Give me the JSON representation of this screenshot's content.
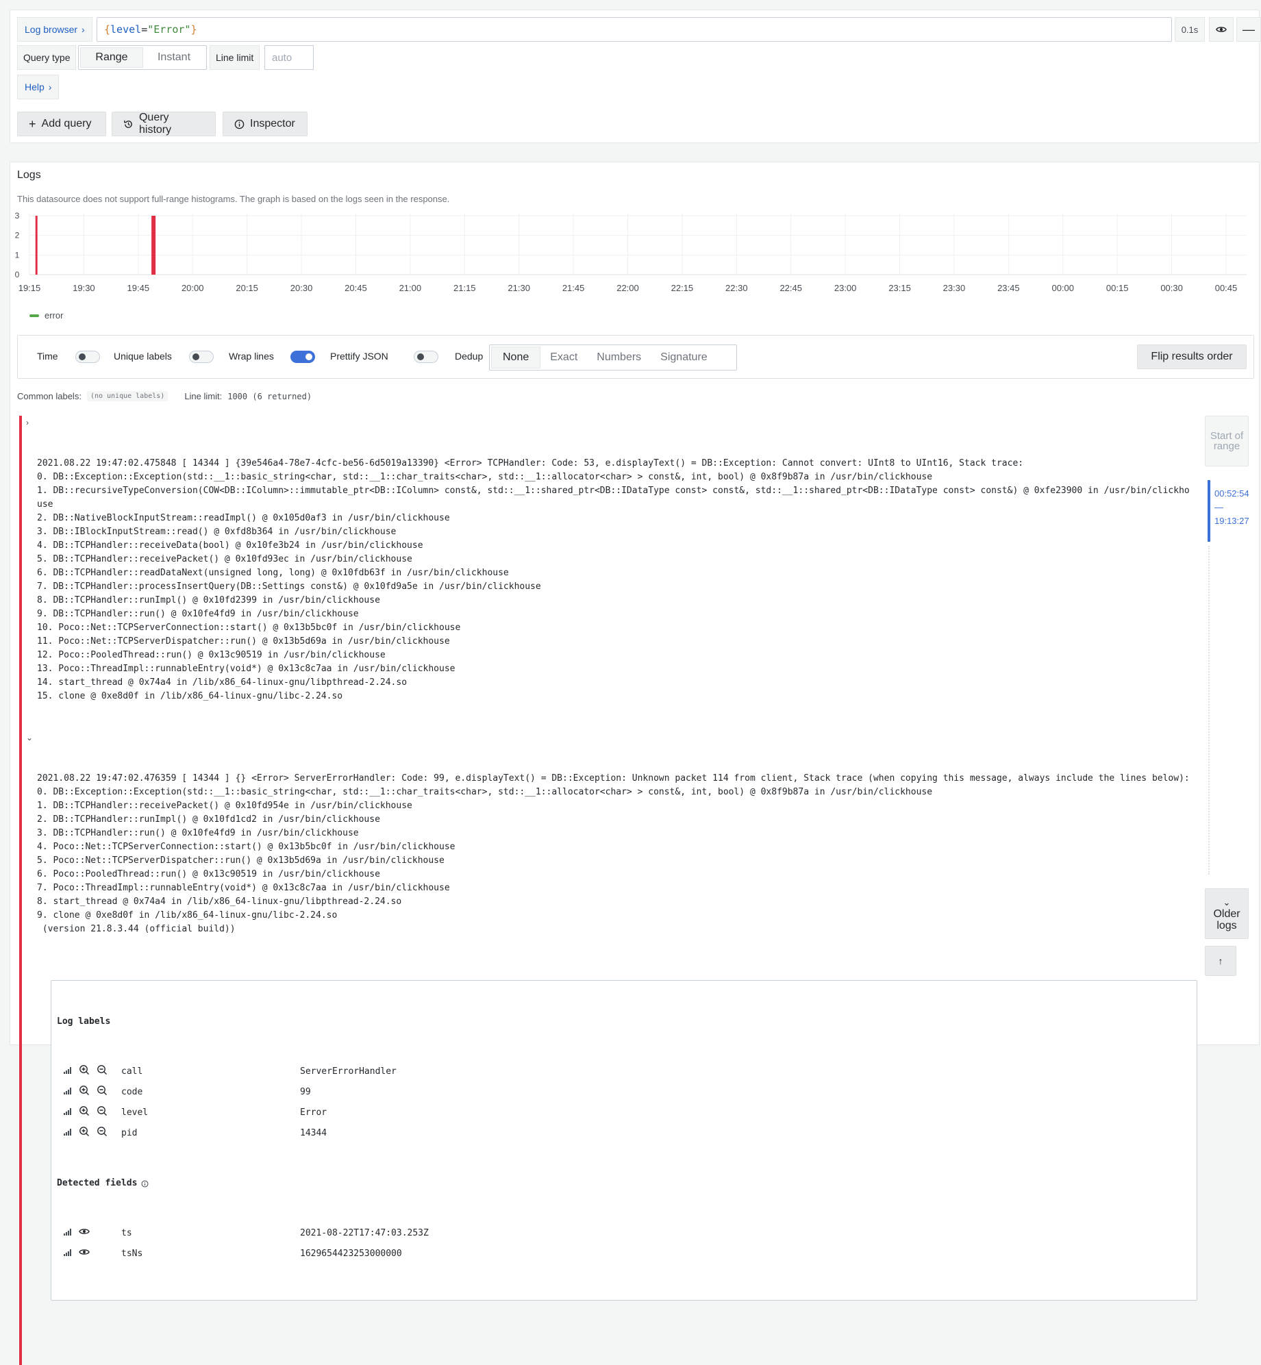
{
  "query_editor": {
    "log_browser_label": "Log browser",
    "query": {
      "brace_open": "{",
      "key": "level",
      "op": "=",
      "value": "\"Error\"",
      "brace_close": "}"
    },
    "query_time": "0.1s",
    "query_type_label": "Query type",
    "query_type_options": [
      "Range",
      "Instant"
    ],
    "query_type_selected": "Range",
    "line_limit_label": "Line limit",
    "line_limit_placeholder": "auto",
    "help_label": "Help",
    "add_query_label": "Add query",
    "query_history_label": "Query history",
    "inspector_label": "Inspector"
  },
  "logs": {
    "title": "Logs",
    "histogram_note": "This datasource does not support full-range histograms. The graph is based on the logs seen in the response.",
    "options": {
      "time_label": "Time",
      "time_on": false,
      "unique_labels_label": "Unique labels",
      "unique_labels_on": false,
      "wrap_lines_label": "Wrap lines",
      "wrap_lines_on": true,
      "prettify_json_label": "Prettify JSON",
      "prettify_json_on": false,
      "dedup_label": "Dedup",
      "dedup_options": [
        "None",
        "Exact",
        "Numbers",
        "Signature"
      ],
      "dedup_selected": "None",
      "flip_label": "Flip results order"
    },
    "common_labels_label": "Common labels:",
    "common_labels_value": "(no unique labels)",
    "line_limit_label": "Line limit:",
    "line_limit_value": "1000 (6 returned)",
    "rows": [
      {
        "expanded": false,
        "lines": [
          "2021.08.22 19:47:02.475848 [ 14344 ] {39e546a4-78e7-4cfc-be56-6d5019a13390} <Error> TCPHandler: Code: 53, e.displayText() = DB::Exception: Cannot convert: UInt8 to UInt16, Stack trace:",
          "0. DB::Exception::Exception(std::__1::basic_string<char, std::__1::char_traits<char>, std::__1::allocator<char> > const&, int, bool) @ 0x8f9b87a in /usr/bin/clickhouse",
          "1. DB::recursiveTypeConversion(COW<DB::IColumn>::immutable_ptr<DB::IColumn> const&, std::__1::shared_ptr<DB::IDataType const> const&, std::__1::shared_ptr<DB::IDataType const> const&) @ 0xfe23900 in /usr/bin/clickhouse",
          "2. DB::NativeBlockInputStream::readImpl() @ 0x105d0af3 in /usr/bin/clickhouse",
          "3. DB::IBlockInputStream::read() @ 0xfd8b364 in /usr/bin/clickhouse",
          "4. DB::TCPHandler::receiveData(bool) @ 0x10fe3b24 in /usr/bin/clickhouse",
          "5. DB::TCPHandler::receivePacket() @ 0x10fd93ec in /usr/bin/clickhouse",
          "6. DB::TCPHandler::readDataNext(unsigned long, long) @ 0x10fdb63f in /usr/bin/clickhouse",
          "7. DB::TCPHandler::processInsertQuery(DB::Settings const&) @ 0x10fd9a5e in /usr/bin/clickhouse",
          "8. DB::TCPHandler::runImpl() @ 0x10fd2399 in /usr/bin/clickhouse",
          "9. DB::TCPHandler::run() @ 0x10fe4fd9 in /usr/bin/clickhouse",
          "10. Poco::Net::TCPServerConnection::start() @ 0x13b5bc0f in /usr/bin/clickhouse",
          "11. Poco::Net::TCPServerDispatcher::run() @ 0x13b5d69a in /usr/bin/clickhouse",
          "12. Poco::PooledThread::run() @ 0x13c90519 in /usr/bin/clickhouse",
          "13. Poco::ThreadImpl::runnableEntry(void*) @ 0x13c8c7aa in /usr/bin/clickhouse",
          "14. start_thread @ 0x74a4 in /lib/x86_64-linux-gnu/libpthread-2.24.so",
          "15. clone @ 0xe8d0f in /lib/x86_64-linux-gnu/libc-2.24.so"
        ]
      },
      {
        "expanded": true,
        "lines": [
          "2021.08.22 19:47:02.476359 [ 14344 ] {} <Error> ServerErrorHandler: Code: 99, e.displayText() = DB::Exception: Unknown packet 114 from client, Stack trace (when copying this message, always include the lines below):",
          "0. DB::Exception::Exception(std::__1::basic_string<char, std::__1::char_traits<char>, std::__1::allocator<char> > const&, int, bool) @ 0x8f9b87a in /usr/bin/clickhouse",
          "1. DB::TCPHandler::receivePacket() @ 0x10fd954e in /usr/bin/clickhouse",
          "2. DB::TCPHandler::runImpl() @ 0x10fd1cd2 in /usr/bin/clickhouse",
          "3. DB::TCPHandler::run() @ 0x10fe4fd9 in /usr/bin/clickhouse",
          "4. Poco::Net::TCPServerConnection::start() @ 0x13b5bc0f in /usr/bin/clickhouse",
          "5. Poco::Net::TCPServerDispatcher::run() @ 0x13b5d69a in /usr/bin/clickhouse",
          "6. Poco::PooledThread::run() @ 0x13c90519 in /usr/bin/clickhouse",
          "7. Poco::ThreadImpl::runnableEntry(void*) @ 0x13c8c7aa in /usr/bin/clickhouse",
          "8. start_thread @ 0x74a4 in /lib/x86_64-linux-gnu/libpthread-2.24.so",
          "9. clone @ 0xe8d0f in /lib/x86_64-linux-gnu/libc-2.24.so",
          " (version 21.8.3.44 (official build))"
        ],
        "details": {
          "labels_title": "Log labels",
          "labels": [
            {
              "key": "call",
              "value": "ServerErrorHandler"
            },
            {
              "key": "code",
              "value": "99"
            },
            {
              "key": "level",
              "value": "Error"
            },
            {
              "key": "pid",
              "value": "14344"
            }
          ],
          "fields_title": "Detected fields",
          "fields": [
            {
              "key": "ts",
              "value": "2021-08-22T17:47:03.253Z"
            },
            {
              "key": "tsNs",
              "value": "1629654423253000000"
            }
          ]
        }
      }
    ],
    "rail": {
      "start_of_range_label": "Start of range",
      "range_start": "00:52:54",
      "range_sep": "—",
      "range_end": "19:13:27",
      "older_logs_label": "Older logs"
    }
  },
  "chart_data": {
    "type": "bar",
    "x": [
      "19:15",
      "19:30",
      "19:45",
      "20:00",
      "20:15",
      "20:30",
      "20:45",
      "21:00",
      "21:15",
      "21:30",
      "21:45",
      "22:00",
      "22:15",
      "22:30",
      "22:45",
      "23:00",
      "23:15",
      "23:30",
      "23:45",
      "00:00",
      "00:15",
      "00:30",
      "00:45"
    ],
    "series": [
      {
        "name": "error",
        "color": "#e02f44",
        "points": [
          {
            "x": "19:14",
            "y": 3
          },
          {
            "x": "19:46",
            "y": 3
          }
        ]
      }
    ],
    "ylim": [
      0,
      3
    ],
    "yticks": [
      0,
      1,
      2,
      3
    ],
    "legend": "bottom-left",
    "legend_swatch_color": "#56a64b",
    "grid": true
  }
}
